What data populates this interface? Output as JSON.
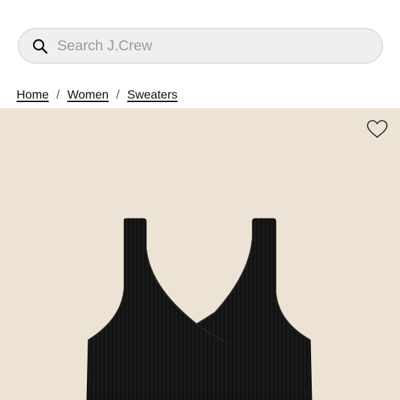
{
  "search": {
    "placeholder": "Search J.Crew",
    "value": ""
  },
  "breadcrumb": {
    "items": [
      "Home",
      "Women",
      "Sweaters"
    ],
    "separator": "/"
  },
  "product": {
    "image_icon": "sweater-tank-image",
    "background_color": "#ece3d5",
    "garment_color": "#141414"
  },
  "icons": {
    "search": "search-icon",
    "wishlist": "heart-icon"
  }
}
